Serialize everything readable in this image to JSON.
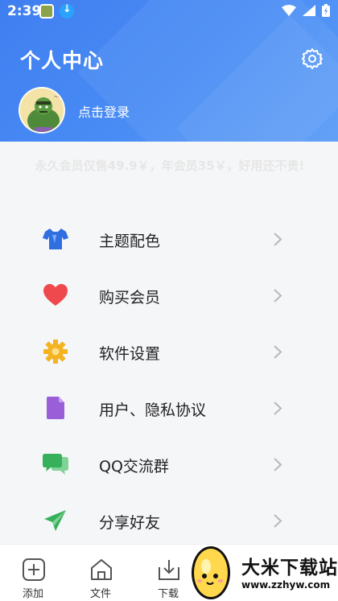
{
  "status_bar": {
    "time": "2:39"
  },
  "header": {
    "title": "个人中心",
    "login_text": "点击登录"
  },
  "notice": "永久会员仅售49.9￥，年会员35￥，好用还不贵!",
  "menu": [
    {
      "label": "主题配色",
      "icon": "shirt-icon",
      "color": "#2f6fe0"
    },
    {
      "label": "购买会员",
      "icon": "heart-icon",
      "color": "#f0494d"
    },
    {
      "label": "软件设置",
      "icon": "gear-icon",
      "color": "#f4b323"
    },
    {
      "label": "用户、隐私协议",
      "icon": "document-icon",
      "color": "#9a5ed8"
    },
    {
      "label": "QQ交流群",
      "icon": "chat-icon",
      "color": "#36b05b"
    },
    {
      "label": "分享好友",
      "icon": "send-icon",
      "color": "#36b05b"
    }
  ],
  "bottom_nav": [
    {
      "label": "添加",
      "icon": "add-icon"
    },
    {
      "label": "文件",
      "icon": "home-icon"
    },
    {
      "label": "下载",
      "icon": "download-icon"
    }
  ],
  "watermark": {
    "title": "大米下载站",
    "url": "www.zzhyw.com"
  },
  "colors": {
    "header_start": "#3f7ef0",
    "header_end": "#5b9cf7",
    "background": "#f5f6f8"
  }
}
